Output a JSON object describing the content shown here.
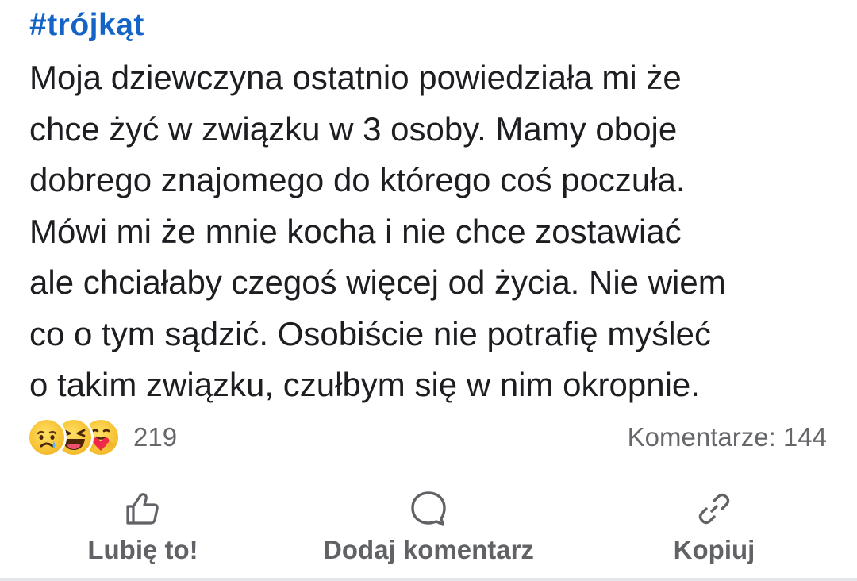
{
  "post": {
    "hashtag": "#trójkąt",
    "text": "Moja dziewczyna ostatnio powiedziała mi że\nchce żyć w związku w 3 osoby. Mamy oboje\ndobrego znajomego do którego coś poczuła.\nMówi mi że mnie kocha i nie chce zostawiać\nale chciałaby czegoś więcej od życia. Nie wiem\nco o tym sądzić. Osobiście nie potrafię myśleć\no takim związku, czułbym się w nim okropnie."
  },
  "stats": {
    "reactions": [
      "sad-emoji-icon",
      "haha-emoji-icon",
      "care-emoji-icon"
    ],
    "reaction_count": "219",
    "comments_label": "Komentarze: 144"
  },
  "actions": {
    "like": {
      "label": "Lubię to!",
      "icon": "thumbs-up-icon"
    },
    "comment": {
      "label": "Dodaj komentarz",
      "icon": "speech-bubble-icon"
    },
    "copy": {
      "label": "Kopiuj",
      "icon": "link-icon"
    }
  },
  "colors": {
    "hashtag": "#1464c8",
    "text": "#1c1e21",
    "muted": "#65676b",
    "action_label": "#606266"
  }
}
